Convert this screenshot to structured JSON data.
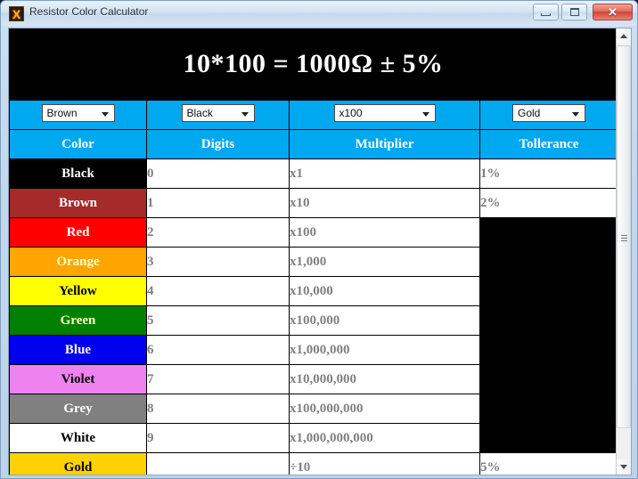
{
  "window": {
    "title": "Resistor Color Calculator",
    "icon": "app-x-icon",
    "icon_glyph": "X",
    "minimize_label": "Minimize",
    "maximize_label": "Maximize",
    "close_label": "Close",
    "close_glyph": "✕"
  },
  "header": {
    "equation": "10*100 = 1000Ω ± 5%"
  },
  "selectors": [
    {
      "name": "first-digit-select",
      "value": "Brown"
    },
    {
      "name": "second-digit-select",
      "value": "Black"
    },
    {
      "name": "multiplier-select",
      "value": "x100"
    },
    {
      "name": "tolerance-select",
      "value": "Gold"
    }
  ],
  "table": {
    "headers": [
      "Color",
      "Digits",
      "Multiplier",
      "Tollerance"
    ],
    "rows": [
      {
        "color": "Black",
        "bg": "#000000",
        "fg": "#FFFFFF",
        "digit": "0",
        "multiplier": "x1",
        "tolerance": "1%"
      },
      {
        "color": "Brown",
        "bg": "#A52A2A",
        "fg": "#FFFFFF",
        "digit": "1",
        "multiplier": "x10",
        "tolerance": "2%"
      },
      {
        "color": "Red",
        "bg": "#FF0000",
        "fg": "#FFFFFF",
        "digit": "2",
        "multiplier": "x100",
        "tolerance": ""
      },
      {
        "color": "Orange",
        "bg": "#FFA500",
        "fg": "#FFFFC0",
        "digit": "3",
        "multiplier": "x1,000",
        "tolerance": ""
      },
      {
        "color": "Yellow",
        "bg": "#FFFF00",
        "fg": "#000000",
        "digit": "4",
        "multiplier": "x10,000",
        "tolerance": ""
      },
      {
        "color": "Green",
        "bg": "#008000",
        "fg": "#FFFFC0",
        "digit": "5",
        "multiplier": "x100,000",
        "tolerance": ""
      },
      {
        "color": "Blue",
        "bg": "#0000EE",
        "fg": "#FFFFFF",
        "digit": "6",
        "multiplier": "x1,000,000",
        "tolerance": ""
      },
      {
        "color": "Violet",
        "bg": "#EE82EE",
        "fg": "#000000",
        "digit": "7",
        "multiplier": "x10,000,000",
        "tolerance": ""
      },
      {
        "color": "Grey",
        "bg": "#808080",
        "fg": "#FFFFFF",
        "digit": "8",
        "multiplier": "x100,000,000",
        "tolerance": ""
      },
      {
        "color": "White",
        "bg": "#FFFFFF",
        "fg": "#000000",
        "digit": "9",
        "multiplier": "x1,000,000,000",
        "tolerance": ""
      },
      {
        "color": "Gold",
        "bg": "#FFD100",
        "fg": "#000000",
        "digit": "",
        "multiplier": "÷10",
        "tolerance": "5%"
      }
    ]
  },
  "scrollbar": {
    "up_label": "Scroll up",
    "down_label": "Scroll down",
    "thumb_label": "Scroll thumb"
  },
  "colors": {
    "accent": "#00A8F0",
    "header_bg": "#000000",
    "value_text": "#808080"
  }
}
